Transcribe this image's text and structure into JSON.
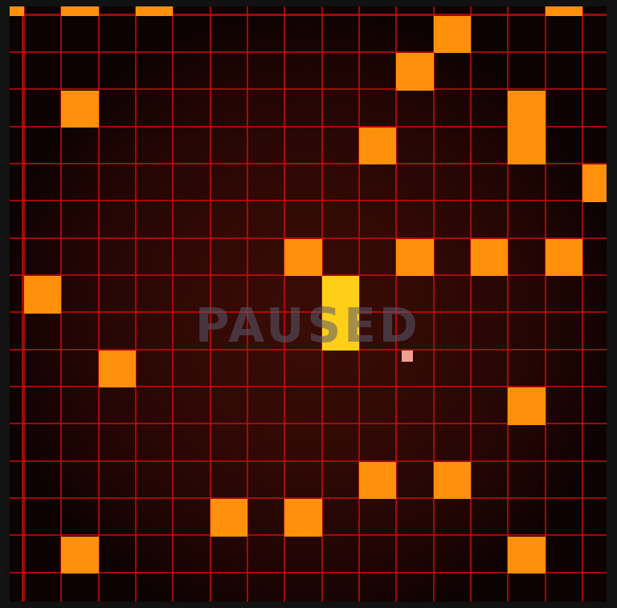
{
  "game": {
    "status": "PAUSED"
  },
  "cells": [
    {
      "col": -1,
      "row": -1,
      "kind": "block"
    },
    {
      "col": 1,
      "row": -1,
      "kind": "block"
    },
    {
      "col": 3,
      "row": -1,
      "kind": "block"
    },
    {
      "col": 14,
      "row": -1,
      "kind": "block"
    },
    {
      "col": 11,
      "row": 0,
      "kind": "block"
    },
    {
      "col": 10,
      "row": 1,
      "kind": "block"
    },
    {
      "col": 1,
      "row": 2,
      "kind": "block"
    },
    {
      "col": 13,
      "row": 2,
      "kind": "block"
    },
    {
      "col": 13,
      "row": 3,
      "kind": "block"
    },
    {
      "col": 9,
      "row": 3,
      "kind": "block"
    },
    {
      "col": 15,
      "row": 4,
      "kind": "block"
    },
    {
      "col": 7,
      "row": 6,
      "kind": "block"
    },
    {
      "col": 10,
      "row": 6,
      "kind": "block"
    },
    {
      "col": 12,
      "row": 6,
      "kind": "block"
    },
    {
      "col": 14,
      "row": 6,
      "kind": "block"
    },
    {
      "col": 8,
      "row": 7,
      "kind": "head"
    },
    {
      "col": 8,
      "row": 8,
      "kind": "head"
    },
    {
      "col": 0,
      "row": 7,
      "kind": "block"
    },
    {
      "col": 2,
      "row": 9,
      "kind": "block"
    },
    {
      "col": 13,
      "row": 10,
      "kind": "block"
    },
    {
      "col": 9,
      "row": 12,
      "kind": "block"
    },
    {
      "col": 11,
      "row": 12,
      "kind": "block"
    },
    {
      "col": 5,
      "row": 13,
      "kind": "block"
    },
    {
      "col": 7,
      "row": 13,
      "kind": "block"
    },
    {
      "col": 1,
      "row": 14,
      "kind": "block"
    },
    {
      "col": 13,
      "row": 14,
      "kind": "block"
    }
  ],
  "food": {
    "col": 10,
    "row": 9
  }
}
